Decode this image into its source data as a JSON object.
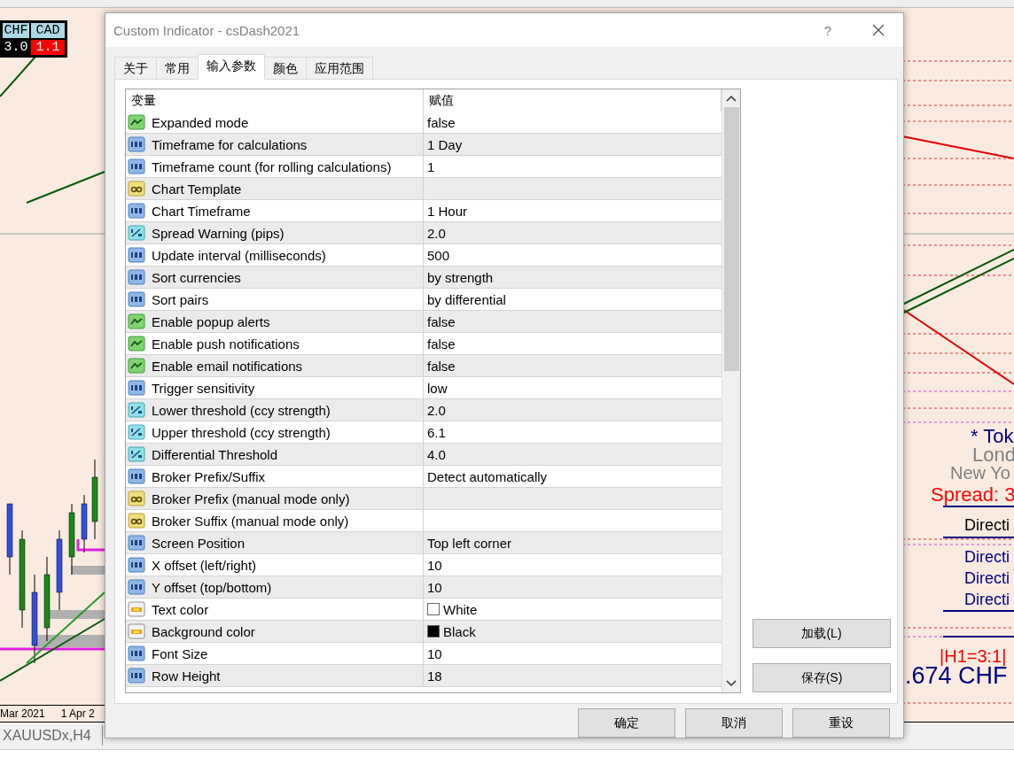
{
  "chart": {
    "currency_table": {
      "headers": [
        "CHF",
        "CAD"
      ],
      "values": [
        {
          "text": "3.0",
          "color": "#000000"
        },
        {
          "text": "1.1",
          "color": "#ff0000"
        }
      ]
    },
    "session_labels": [
      {
        "text": "* Tok",
        "color": "#000080"
      },
      {
        "text": "Lond",
        "color": "#808080"
      },
      {
        "text": "New Yo",
        "color": "#808080"
      },
      {
        "text": "Spread: 3",
        "color": "#ff0000"
      },
      {
        "text": "Directi",
        "color": "#000000"
      },
      {
        "text": "Directi",
        "color": "#000080"
      },
      {
        "text": "Directi",
        "color": "#000080"
      },
      {
        "text": "Directi",
        "color": "#000080"
      },
      {
        "text": "|H1=3:1|",
        "color": "#ff0000"
      },
      {
        "text": ".674 CHF",
        "color": "#000080"
      }
    ],
    "date_labels": [
      "Mar 2021",
      "1 Apr 2"
    ]
  },
  "dialog": {
    "title": "Custom Indicator - csDash2021",
    "help": "?",
    "tabs": [
      {
        "label": "关于",
        "selected": false
      },
      {
        "label": "常用",
        "selected": false
      },
      {
        "label": "输入参数",
        "selected": true
      },
      {
        "label": "颜色",
        "selected": false
      },
      {
        "label": "应用范围",
        "selected": false
      }
    ],
    "columns": [
      "变量",
      "赋值"
    ],
    "rows": [
      {
        "kind": "bool",
        "name": "Expanded mode",
        "value": "false"
      },
      {
        "kind": "int",
        "name": "Timeframe for calculations",
        "value": "1 Day"
      },
      {
        "kind": "int",
        "name": "Timeframe count (for rolling calculations)",
        "value": "1"
      },
      {
        "kind": "string",
        "name": "Chart Template"
      },
      {
        "kind": "int",
        "name": "Chart Timeframe",
        "value": "1 Hour"
      },
      {
        "kind": "double",
        "name": "Spread Warning (pips)",
        "value": "2.0"
      },
      {
        "kind": "int",
        "name": "Update interval (milliseconds)",
        "value": "500"
      },
      {
        "kind": "int",
        "name": "Sort currencies",
        "value": "by strength"
      },
      {
        "kind": "int",
        "name": "Sort pairs",
        "value": "by differential"
      },
      {
        "kind": "bool",
        "name": "Enable popup alerts",
        "value": "false"
      },
      {
        "kind": "bool",
        "name": "Enable push notifications",
        "value": "false"
      },
      {
        "kind": "bool",
        "name": "Enable email notifications",
        "value": "false"
      },
      {
        "kind": "int",
        "name": "Trigger sensitivity",
        "value": "low"
      },
      {
        "kind": "double",
        "name": "Lower threshold (ccy strength)",
        "value": "2.0"
      },
      {
        "kind": "double",
        "name": "Upper threshold (ccy strength)",
        "value": "6.1"
      },
      {
        "kind": "double",
        "name": "Differential Threshold",
        "value": "4.0"
      },
      {
        "kind": "int",
        "name": "Broker Prefix/Suffix",
        "value": "Detect automatically"
      },
      {
        "kind": "string",
        "name": "Broker Prefix (manual mode only)"
      },
      {
        "kind": "string",
        "name": "Broker Suffix (manual mode only)"
      },
      {
        "kind": "int",
        "name": "Screen Position",
        "value": "Top left corner"
      },
      {
        "kind": "int",
        "name": "X offset (left/right)",
        "value": "10"
      },
      {
        "kind": "int",
        "name": "Y offset (top/bottom)",
        "value": "10"
      },
      {
        "kind": "color",
        "name": "Text color",
        "value": "White",
        "color": "#ffffff"
      },
      {
        "kind": "color",
        "name": "Background color",
        "value": "Black",
        "color": "#000000"
      },
      {
        "kind": "int",
        "name": "Font Size",
        "value": "10"
      },
      {
        "kind": "int",
        "name": "Row Height",
        "value": "18"
      }
    ],
    "side_buttons": [
      "加载(L)",
      "保存(S)"
    ],
    "buttons": [
      "确定",
      "取消",
      "重设"
    ]
  },
  "symbol_tabs": [
    {
      "label": "XAUUSDx,H4",
      "selected": false
    }
  ]
}
